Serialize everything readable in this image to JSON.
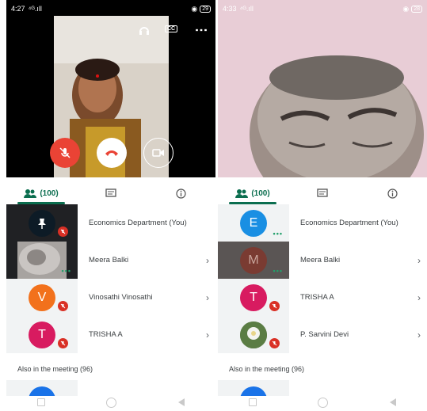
{
  "left": {
    "status": {
      "time": "4:27",
      "signal": "⁴ᴳ.ıll",
      "battery": "29"
    },
    "tabs": {
      "people": "(100)"
    },
    "participants": [
      {
        "name": "Economics Department (You)"
      },
      {
        "name": "Meera Balki"
      },
      {
        "name": "Vinosathi Vinosathi",
        "initial": "V",
        "color": "#f2711c"
      },
      {
        "name": "TRISHA A",
        "initial": "T",
        "color": "#d81b60"
      }
    ],
    "also": "Also in the meeting (96)"
  },
  "right": {
    "status": {
      "time": "4:33",
      "signal": "⁴ᴳ.ıll",
      "battery": "28"
    },
    "tabs": {
      "people": "(100)"
    },
    "participants": [
      {
        "name": "Economics Department (You)",
        "initial": "E",
        "color": "#1a8fe3"
      },
      {
        "name": "Meera Balki",
        "initial": "M",
        "color": "#7a3b32"
      },
      {
        "name": "TRISHA A",
        "initial": "T",
        "color": "#d81b60"
      },
      {
        "name": "P. Sarvini Devi"
      }
    ],
    "also": "Also in the meeting (96)"
  },
  "icons": {
    "headphones": "headphones-icon",
    "captions": "CC",
    "more": "⋮",
    "people": "people-icon",
    "chat": "chat-icon",
    "info": "info-icon"
  }
}
